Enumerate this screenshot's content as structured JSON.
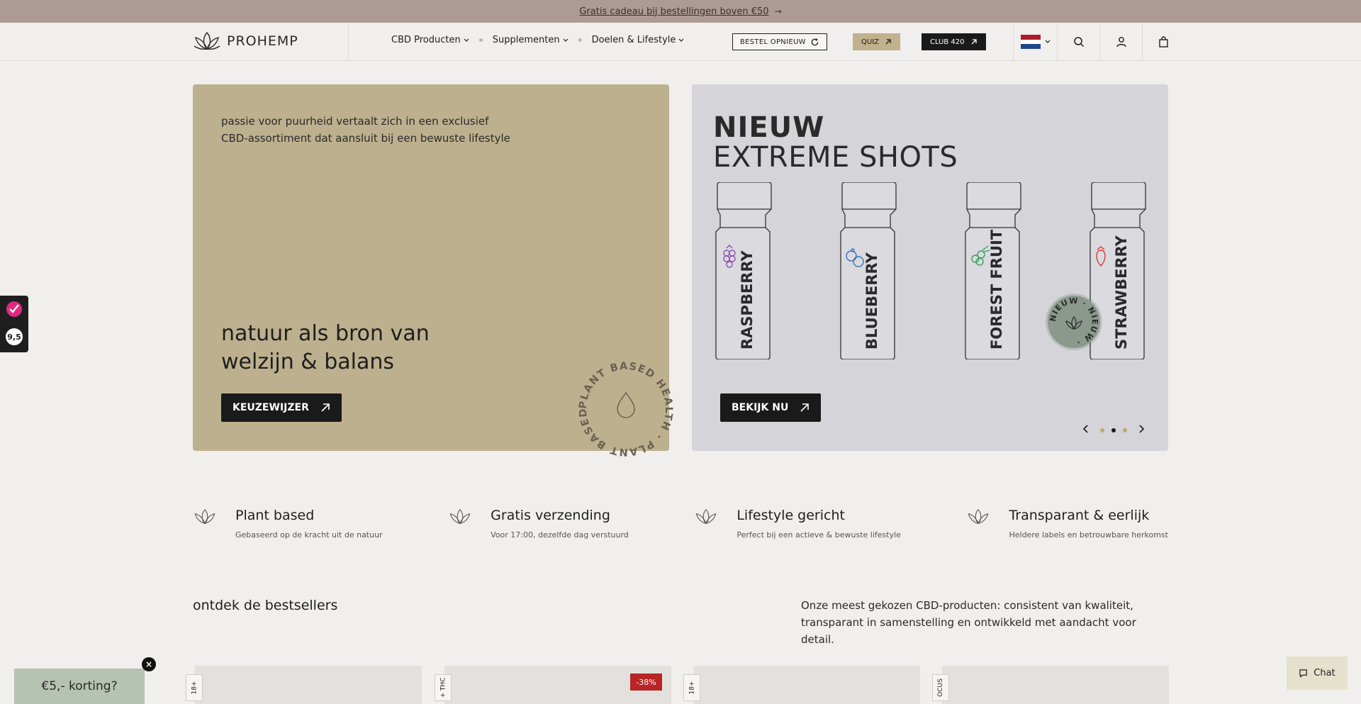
{
  "announcement": {
    "text": "Gratis cadeau bij bestellingen boven €50",
    "arrow": "→"
  },
  "header": {
    "logo_text": "PROHEMP",
    "nav": [
      {
        "label": "CBD Producten"
      },
      {
        "label": "Supplementen"
      },
      {
        "label": "Doelen & Lifestyle"
      }
    ],
    "reorder_label": "BESTEL OPNIEUW",
    "quiz_label": "QUIZ",
    "club_label": "CLUB 420",
    "icons": [
      "flag-nl-icon",
      "search-icon",
      "account-icon",
      "bag-icon"
    ]
  },
  "hero_left": {
    "intro": "passie voor puurheid vertaalt zich in een exclusief CBD-assortiment dat aansluit bij een bewuste lifestyle",
    "headline": "natuur als bron van welzijn & balans",
    "button": "KEUZEWIJZER",
    "badge_text": "PLANT BASED HEALTH · PLANT BASED HEALTH · "
  },
  "hero_right": {
    "title_line1": "NIEUW",
    "title_line2": "EXTREME SHOTS",
    "bottles": [
      "RASPBERRY",
      "BLUEBERRY",
      "FOREST FRUIT",
      "STRAWBERRY"
    ],
    "new_badge": "NIEUW · NIEUW · ",
    "button": "BEKIJK NU",
    "carousel": {
      "count": 3,
      "active": 2
    }
  },
  "side_widget": {
    "score": "9,5"
  },
  "usps": [
    {
      "title": "Plant based",
      "sub": "Gebaseerd op de kracht uit de natuur"
    },
    {
      "title": "Gratis verzending",
      "sub": "Voor 17:00, dezelfde dag verstuurd"
    },
    {
      "title": "Lifestyle gericht",
      "sub": "Perfect bij een actieve & bewuste lifestyle"
    },
    {
      "title": "Transparant & eerlijk",
      "sub": "Heldere labels en betrouwbare herkomst"
    }
  ],
  "bestsellers": {
    "title": "ontdek de bestsellers",
    "description": "Onze meest gekozen CBD-producten: consistent van kwaliteit, transparant in samenstelling en ontwikkeld met aandacht voor detail.",
    "tags": [
      "18+",
      "+ THC",
      "18+",
      "OCUS"
    ],
    "discount": "-38%"
  },
  "promo": {
    "label": "€5,- korting?",
    "close": "×"
  },
  "chat": {
    "label": "Chat"
  },
  "colors": {
    "announce_bg": "#ad9a96",
    "hero_left_bg": "#bdb08e",
    "hero_right_bg": "#d4d4d9",
    "quiz_bg": "#c1b18d",
    "dark": "#1a1a1a",
    "discount": "#b72525"
  }
}
